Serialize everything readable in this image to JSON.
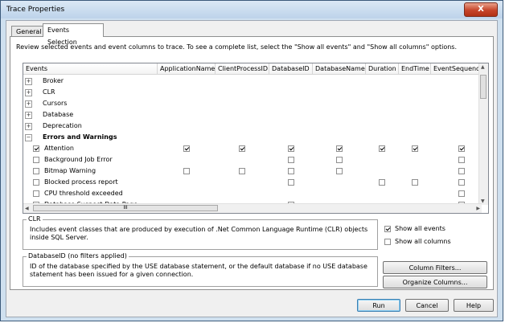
{
  "window": {
    "title": "Trace Properties",
    "close_glyph": "X"
  },
  "tabs": [
    {
      "label": "General"
    },
    {
      "label": "Events Selection"
    }
  ],
  "description": "Review selected events and event columns to trace. To see a complete list, select the \"Show all events\" and \"Show all columns\" options.",
  "grid": {
    "columns": [
      "Events",
      "ApplicationName",
      "ClientProcessID",
      "DatabaseID",
      "DatabaseName",
      "Duration",
      "EndTime",
      "EventSequence"
    ],
    "categories": [
      {
        "label": "Broker"
      },
      {
        "label": "CLR"
      },
      {
        "label": "Cursors"
      },
      {
        "label": "Database"
      },
      {
        "label": "Deprecation"
      },
      {
        "label": "Errors and Warnings"
      }
    ],
    "events": [
      {
        "label": "Attention",
        "selected": true,
        "cols": [
          "checked",
          "checked",
          "checked",
          "checked",
          "checked",
          "checked",
          "checked"
        ]
      },
      {
        "label": "Background Job Error",
        "selected": false,
        "cols": [
          "none",
          "none",
          "empty",
          "empty",
          "none",
          "none",
          "empty"
        ]
      },
      {
        "label": "Bitmap Warning",
        "selected": false,
        "cols": [
          "empty",
          "empty",
          "empty",
          "empty",
          "none",
          "none",
          "empty"
        ]
      },
      {
        "label": "Blocked process report",
        "selected": false,
        "cols": [
          "none",
          "none",
          "empty",
          "none",
          "empty",
          "empty",
          "empty"
        ]
      },
      {
        "label": "CPU threshold exceeded",
        "selected": false,
        "cols": [
          "none",
          "none",
          "none",
          "none",
          "none",
          "none",
          "empty"
        ]
      },
      {
        "label": "Database Suspect Data Page",
        "selected": false,
        "cols": [
          "none",
          "none",
          "empty",
          "none",
          "none",
          "none",
          "empty"
        ]
      }
    ],
    "expand_collapsed": "+",
    "expand_open": "−",
    "hscroll_grip": "III"
  },
  "clr_group": {
    "title": "CLR",
    "text": "Includes event classes that are produced by execution of .Net Common Language Runtime (CLR) objects inside SQL Server."
  },
  "options": {
    "show_all_events": "Show all events",
    "show_all_events_checked": true,
    "show_all_columns": "Show all columns",
    "show_all_columns_checked": false
  },
  "db_group": {
    "title": "DatabaseID (no filters applied)",
    "text": "ID of the database specified by the USE database statement, or the default database if no USE database statement has been issued for a given connection."
  },
  "buttons": {
    "column_filters": "Column Filters...",
    "organize_columns": "Organize Columns...",
    "run": "Run",
    "cancel": "Cancel",
    "help": "Help"
  }
}
